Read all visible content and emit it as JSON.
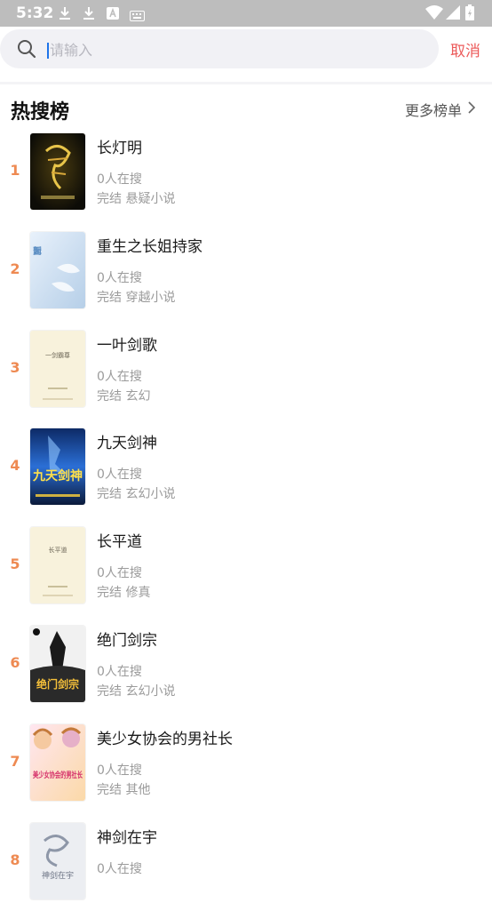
{
  "status_bar": {
    "time": "5:32"
  },
  "search": {
    "placeholder": "请输入",
    "value": "",
    "cancel_label": "取消"
  },
  "section": {
    "title": "热搜榜",
    "more_label": "更多榜单"
  },
  "books": [
    {
      "rank": "1",
      "title": "长灯明",
      "searching": "0人在搜",
      "status": "完结",
      "genre": "悬疑小说",
      "cover_style": "dark-gold"
    },
    {
      "rank": "2",
      "title": "重生之长姐持家",
      "searching": "0人在搜",
      "status": "完结",
      "genre": "穿越小说",
      "cover_style": "no-cover",
      "cover_text": "暂无封面"
    },
    {
      "rank": "3",
      "title": "一叶剑歌",
      "searching": "0人在搜",
      "status": "完结",
      "genre": "玄幻",
      "cover_style": "paper",
      "cover_text": "一剑霸尊"
    },
    {
      "rank": "4",
      "title": "九天剑神",
      "searching": "0人在搜",
      "status": "完结",
      "genre": "玄幻小说",
      "cover_style": "blue-battle",
      "cover_text": "九天剑神"
    },
    {
      "rank": "5",
      "title": "长平道",
      "searching": "0人在搜",
      "status": "完结",
      "genre": "修真",
      "cover_style": "paper",
      "cover_text": "长平道"
    },
    {
      "rank": "6",
      "title": "绝门剑宗",
      "searching": "0人在搜",
      "status": "完结",
      "genre": "玄幻小说",
      "cover_style": "dark-warrior",
      "cover_text": "绝门剑宗"
    },
    {
      "rank": "7",
      "title": "美少女协会的男社长",
      "searching": "0人在搜",
      "status": "完结",
      "genre": "其他",
      "cover_style": "anime",
      "cover_text": "美少女协会的男社长"
    },
    {
      "rank": "8",
      "title": "神剑在宇",
      "searching": "0人在搜",
      "status": "",
      "genre": "",
      "cover_style": "ink",
      "cover_text": "神剑在宇"
    }
  ],
  "colors": {
    "accent": "#ec5a5a",
    "rank": "#ee8a52",
    "muted": "#9b9b9b"
  }
}
